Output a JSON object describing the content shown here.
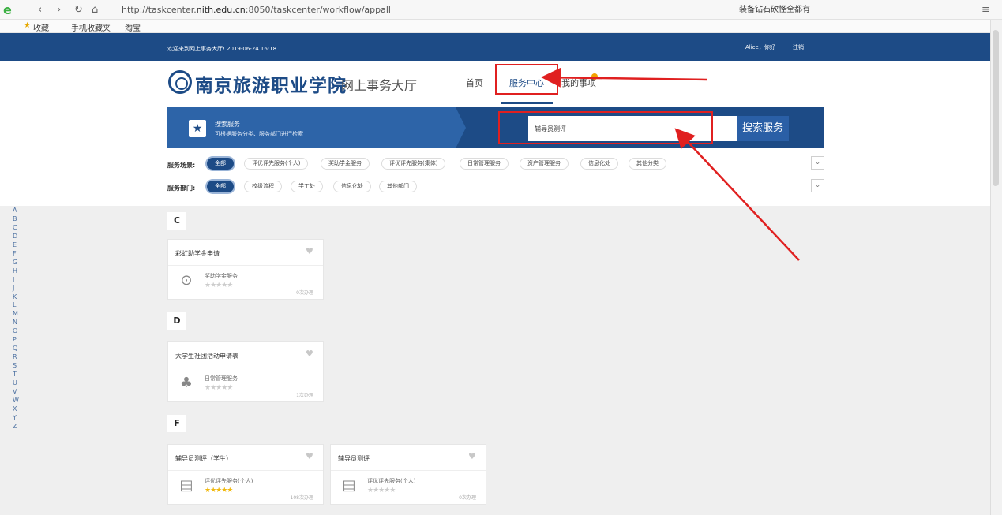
{
  "browser": {
    "url_prefix": "http://taskcenter.",
    "url_domain": "nith.edu.cn",
    "url_suffix": ":8050/taskcenter/workflow/appall",
    "right_search": "装备钻石砍怪全都有"
  },
  "bookmarks": {
    "fav": "收藏",
    "mobile": "手机收藏夹",
    "taobao": "淘宝"
  },
  "header": {
    "welcome": "欢迎来到网上事务大厅! 2019-06-24 16:18",
    "user": "Alice，你好",
    "logout": "注销"
  },
  "brand": {
    "school": "南京旅游职业学院",
    "hall": "网上事务大厅"
  },
  "nav": {
    "home": "首页",
    "service": "服务中心",
    "mine": "我的事项"
  },
  "search": {
    "title": "搜索服务",
    "subtitle": "可根据服务分类、服务部门进行检索",
    "value": "辅导员测评",
    "button": "搜索服务"
  },
  "filters": {
    "scene_label": "服务场景:",
    "scenes": [
      "全部",
      "评优评先服务(个人)",
      "奖助学金服务",
      "评优评先服务(集体)",
      "日常管理服务",
      "资产管理服务",
      "信息化处",
      "其他分类"
    ],
    "dept_label": "服务部门:",
    "depts": [
      "全部",
      "校级流程",
      "学工处",
      "信息化处",
      "其他部门"
    ]
  },
  "alphabet": "A\nB\nC\nD\nE\nF\nG\nH\nI\nJ\nK\nL\nM\nN\nO\nP\nQ\nR\nS\nT\nU\nV\nW\nX\nY\nZ",
  "sections": [
    {
      "letter": "C",
      "cards": [
        {
          "title": "彩虹助学金申请",
          "category": "奖助学金服务",
          "count": "0次办理",
          "rated": false
        }
      ]
    },
    {
      "letter": "D",
      "cards": [
        {
          "title": "大学生社团活动申请表",
          "category": "日常管理服务",
          "count": "1次办理",
          "rated": false
        }
      ]
    },
    {
      "letter": "F",
      "cards": [
        {
          "title": "辅导员测评（学生）",
          "category": "评优评先服务(个人)",
          "count": "108次办理",
          "rated": true
        },
        {
          "title": "辅导员测评",
          "category": "评优评先服务(个人)",
          "count": "0次办理",
          "rated": false
        }
      ]
    }
  ],
  "card_stars": "★★★★★",
  "icons": {
    "heart": "heart-icon",
    "star": "star-icon"
  },
  "colors": {
    "brand": "#1d4b86",
    "accent": "#2d64a8",
    "annotation": "#e02020",
    "star": "#f1b90f"
  }
}
